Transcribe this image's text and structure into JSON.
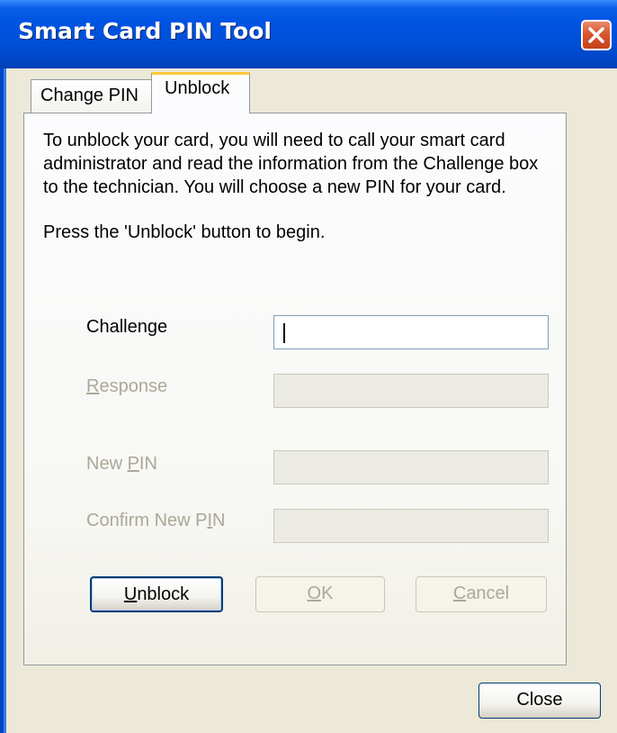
{
  "window": {
    "title": "Smart Card PIN Tool"
  },
  "tabs": [
    {
      "label": "Change PIN",
      "selected": false
    },
    {
      "label": "Unblock",
      "selected": true
    }
  ],
  "unblock": {
    "instructions": "To unblock your card, you will need to call your smart card administrator and read the information from the Challenge box to the technician.  You will choose a new PIN for your card.",
    "press_hint": "Press the 'Unblock' button to begin.",
    "fields": [
      {
        "label": "Challenge",
        "value": "",
        "enabled": true,
        "focused": true
      },
      {
        "label_mn": "R",
        "label_rest": "esponse",
        "value": "",
        "enabled": false
      },
      {
        "label_pre": "New ",
        "label_mn": "P",
        "label_rest": "IN",
        "value": "",
        "enabled": false
      },
      {
        "label_pre": "Confirm New P",
        "label_mn": "I",
        "label_rest": "N",
        "value": "",
        "enabled": false
      }
    ],
    "buttons": {
      "unblock_mn": "U",
      "unblock_rest": "nblock",
      "ok_mn": "O",
      "ok_rest": "K",
      "cancel_mn": "C",
      "cancel_rest": "ancel"
    }
  },
  "footer": {
    "close_label": "Close"
  },
  "colors": {
    "titlebar": "#0054e3",
    "face": "#ece9d8",
    "disabled_text": "#aca899",
    "tab_highlight": "#ffc83c"
  }
}
